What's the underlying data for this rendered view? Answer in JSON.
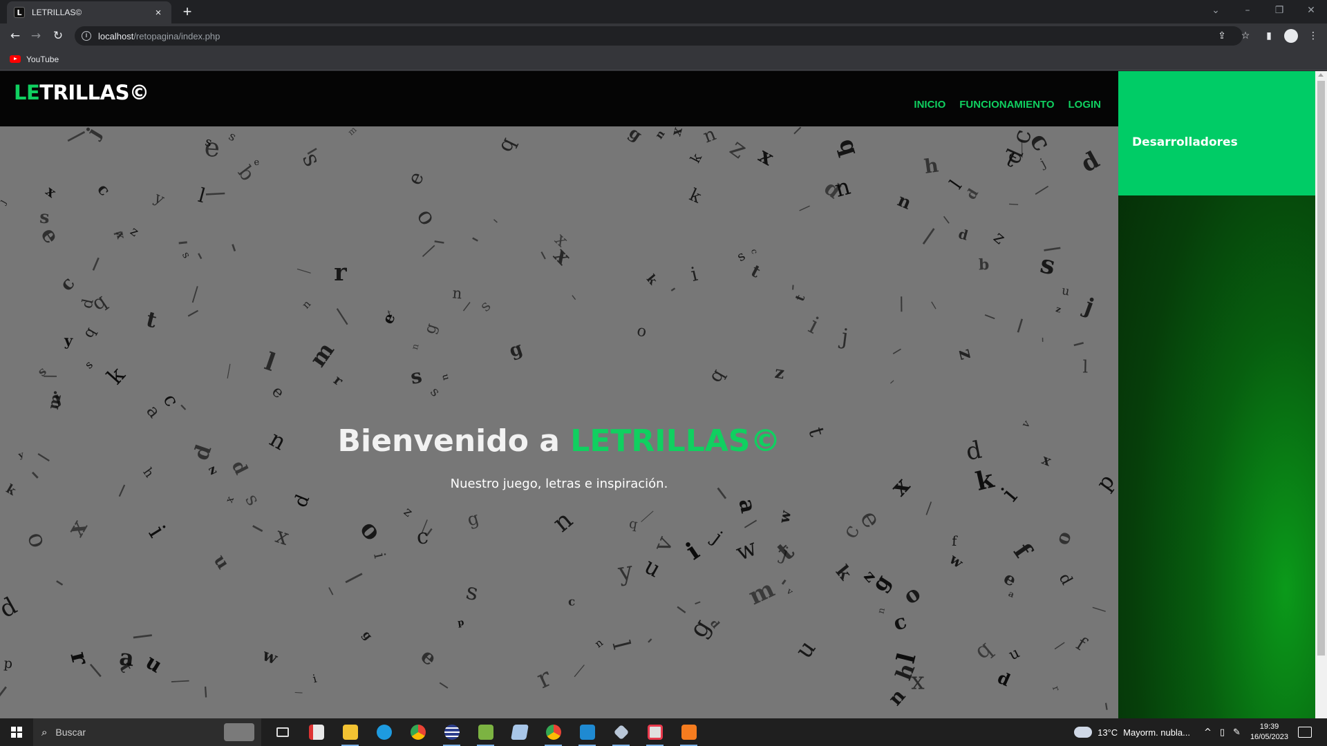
{
  "browser": {
    "tab_title": "LETRILLAS©",
    "tab_favicon_letter": "L",
    "tab_close": "×",
    "new_tab": "+",
    "url_host": "localhost",
    "url_path": "/retopagina/index.php",
    "bookmarks": [
      {
        "label": "YouTube"
      }
    ]
  },
  "page": {
    "logo_prefix": "LE",
    "logo_rest": "TRILLAS©",
    "nav": [
      {
        "label": "INICIO"
      },
      {
        "label": "FUNCIONAMIENTO"
      },
      {
        "label": "LOGIN"
      }
    ],
    "hero_title_prefix": "Bienvenido a ",
    "hero_title_brand": "LETRILLAS©",
    "hero_subtitle": "Nuestro juego, letras e inspiración.",
    "side_panel_label": "Desarrolladores",
    "accent_color": "#10d060",
    "scatter_letters": [
      "b",
      "q",
      "v",
      "u",
      "y",
      "j",
      "k",
      "f",
      "p",
      "h",
      "d",
      "a",
      "g",
      "w",
      "x",
      "n",
      "s",
      "z",
      "o",
      "l",
      "t",
      "e",
      "r",
      "c",
      "m",
      "i"
    ]
  },
  "taskbar": {
    "search_placeholder": "Buscar",
    "apps": [
      "task-view",
      "file-app",
      "explorer",
      "edge",
      "chrome",
      "app-5",
      "android-studio",
      "app-7",
      "chrome-2",
      "vscode",
      "virtualbox",
      "app-11",
      "xampp"
    ],
    "weather_temp": "13°C",
    "weather_text": "Mayorm. nubla...",
    "time": "19:39",
    "date": "16/05/2023"
  }
}
